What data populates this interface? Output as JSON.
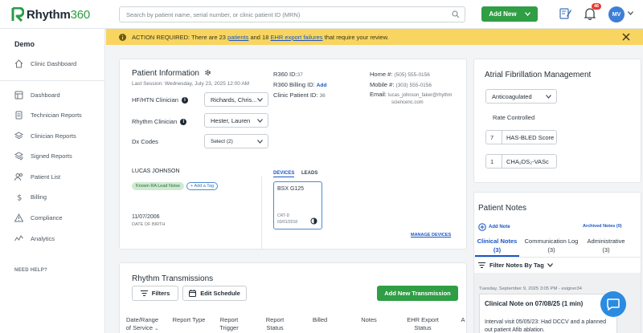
{
  "app": {
    "brand": "Rhythm",
    "brand_number": "360",
    "search_placeholder": "Search by patient name, serial number, or clinic patient ID (MRN)",
    "add_new": "Add New",
    "notifications_count": "46",
    "user_initials": "MV"
  },
  "sidebar": {
    "org": "Demo",
    "items": [
      {
        "label": "Clinic Dashboard",
        "icon": "home-icon"
      },
      {
        "label": "Dashboard",
        "icon": "dashboard-icon"
      },
      {
        "label": "Technician Reports",
        "icon": "report-icon"
      },
      {
        "label": "Clinician Reports",
        "icon": "layers-icon"
      },
      {
        "label": "Signed Reports",
        "icon": "layers-check-icon"
      },
      {
        "label": "Patient List",
        "icon": "users-icon"
      },
      {
        "label": "Billing",
        "icon": "dollar-icon"
      },
      {
        "label": "Compliance",
        "icon": "warning-icon"
      },
      {
        "label": "Analytics",
        "icon": "analytics-icon"
      }
    ],
    "need_help": "NEED HELP?"
  },
  "banner": {
    "prefix": "ACTION REQUIRED: There are 23",
    "link1": "patients",
    "middle": "and 18",
    "link2": "EHR export failures",
    "suffix": "that require your review."
  },
  "patient_info": {
    "title": "Patient Information",
    "last_session": "Last Session: Wednesday, July 23, 2025 12:00 AM",
    "hf_label": "HF/HTN Clinician",
    "hf_value": "Richards, Chris...",
    "rhythm_label": "Rhythm Clinician",
    "rhythm_value": "Hester, Lauren",
    "dx_label": "Dx Codes",
    "dx_value": "Select (2)",
    "r360_id_label": "R360 ID:",
    "r360_id_value": "37",
    "billing_label": "R360 Billing ID:",
    "billing_add": "Add",
    "clinic_id_label": "Clinic Patient ID:",
    "clinic_id_value": "36",
    "home_label": "Home #:",
    "home_value": "(505) 555-0156",
    "mobile_label": "Mobile #:",
    "mobile_value": "(303) 555-0156",
    "email_label": "Email:",
    "email_line1": "lucas_johnson_faker@rhythm",
    "email_line2": "sciencenc.com",
    "name": "LUCAS JOHNSON",
    "tag": "Known RA Lead Noise",
    "add_tag": "+ Add a Tag",
    "dob": "11/07/2006",
    "dob_label": "DATE OF BIRTH",
    "tab_devices": "DEVICES",
    "tab_leads": "LEADS",
    "device_name": "BSX G125",
    "device_type": "CRT-D",
    "device_date": "03/01/2018",
    "manage_devices": "MANAGE DEVICES"
  },
  "afib": {
    "title": "Atrial Fibrillation Management",
    "status": "Anticoagulated",
    "rate_controlled": "Rate Controlled",
    "has_bled_value": "7",
    "has_bled_label": "HAS-BLED Score",
    "cha_value": "1",
    "cha_label": "CHA₂DS₂-VASc"
  },
  "notes": {
    "title": "Patient Notes",
    "add_note": "Add Note",
    "archived": "Archived Notes (0)",
    "tabs": [
      {
        "label": "Clinical Notes",
        "count": "(3)"
      },
      {
        "label": "Communication Log",
        "count": "(3)"
      },
      {
        "label": "Administrative",
        "count": "(3)"
      }
    ],
    "filter": "Filter Notes By Tag",
    "meta": "Tuesday, September 9, 2025 3:05 PM - esigner34",
    "note_title": "Clinical Note on 07/08/25 (1 min)",
    "note_line1": "Interval visit 05/05/23: Had DCCV and a planned",
    "note_line2": "out patient Afib ablation."
  },
  "transmissions": {
    "title": "Rhythm Transmissions",
    "filters": "Filters",
    "edit_schedule": "Edit Schedule",
    "add_new": "Add New Transmission",
    "col1a": "Date/Range",
    "col1b": "of Service",
    "col2": "Report Type",
    "col3a": "Report",
    "col3b": "Trigger",
    "col4a": "Report",
    "col4b": "Status",
    "col5": "Billed",
    "col6": "Notes",
    "col7a": "EHR Export",
    "col7b": "Status",
    "col8": "A"
  },
  "colors": {
    "accent_green": "#2f9e44",
    "banner_yellow": "#f7d560",
    "link_blue": "#1a56c4"
  }
}
